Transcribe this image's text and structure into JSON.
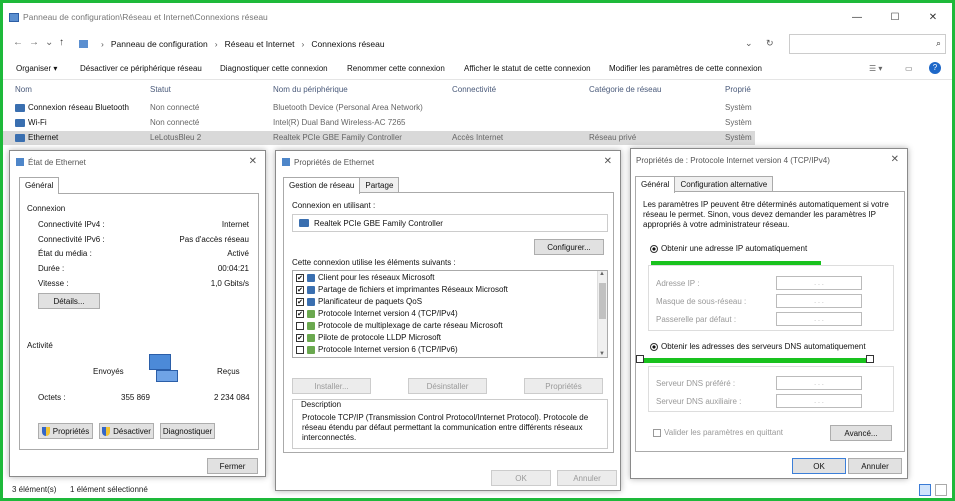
{
  "explorer": {
    "title": "Panneau de configuration\\Réseau et Internet\\Connexions réseau",
    "window_controls": {
      "min": "—",
      "max": "☐",
      "close": "✕"
    },
    "breadcrumb": [
      "Panneau de configuration",
      "Réseau et Internet",
      "Connexions réseau"
    ],
    "commands": [
      "Organiser ▾",
      "Désactiver ce périphérique réseau",
      "Diagnostiquer cette connexion",
      "Renommer cette connexion",
      "Afficher le statut de cette connexion",
      "Modifier les paramètres de cette connexion"
    ],
    "columns": [
      "Nom",
      "Statut",
      "Nom du périphérique",
      "Connectivité",
      "Catégorie de réseau",
      "Proprié"
    ],
    "rows": [
      {
        "name": "Connexion réseau Bluetooth",
        "status": "Non connecté",
        "device": "Bluetooth Device (Personal Area Network)",
        "connectivity": "",
        "category": "",
        "owner": "Systèm"
      },
      {
        "name": "Wi-Fi",
        "status": "Non connecté",
        "device": "Intel(R) Dual Band Wireless-AC 7265",
        "connectivity": "",
        "category": "",
        "owner": "Systèm"
      },
      {
        "name": "Ethernet",
        "status": "LeLotusBleu 2",
        "device": "Realtek PCIe GBE Family Controller",
        "connectivity": "Accès Internet",
        "category": "Réseau privé",
        "owner": "Systèm"
      }
    ],
    "status_count": "3 élément(s)",
    "status_selected": "1 élément sélectionné"
  },
  "etat": {
    "title": "État de Ethernet",
    "tab": "Général",
    "connexion_heading": "Connexion",
    "fields": [
      {
        "label": "Connectivité IPv4 :",
        "value": "Internet"
      },
      {
        "label": "Connectivité IPv6 :",
        "value": "Pas d'accès réseau"
      },
      {
        "label": "État du média :",
        "value": "Activé"
      },
      {
        "label": "Durée :",
        "value": "00:04:21"
      },
      {
        "label": "Vitesse :",
        "value": "1,0 Gbits/s"
      }
    ],
    "details_btn": "Détails...",
    "activite_heading": "Activité",
    "sent_label": "Envoyés",
    "recv_label": "Reçus",
    "octets_label": "Octets :",
    "sent_value": "355 869",
    "recv_value": "2 234 084",
    "btn_props": "Propriétés",
    "btn_disable": "Désactiver",
    "btn_diag": "Diagnostiquer",
    "btn_close": "Fermer"
  },
  "props": {
    "title": "Propriétés de Ethernet",
    "tab1": "Gestion de réseau",
    "tab2": "Partage",
    "conn_using": "Connexion en utilisant :",
    "adapter": "Realtek PCIe GBE Family Controller",
    "configure_btn": "Configurer...",
    "items_label": "Cette connexion utilise les éléments suivants :",
    "items": [
      {
        "label": "Client pour les réseaux Microsoft",
        "checked": "✔"
      },
      {
        "label": "Partage de fichiers et imprimantes Réseaux Microsoft",
        "checked": "✔"
      },
      {
        "label": "Planificateur de paquets QoS",
        "checked": "✔"
      },
      {
        "label": "Protocole Internet version 4 (TCP/IPv4)",
        "checked": "✔"
      },
      {
        "label": "Protocole de multiplexage de carte réseau Microsoft",
        "checked": ""
      },
      {
        "label": "Pilote de protocole LLDP Microsoft",
        "checked": "✔"
      },
      {
        "label": "Protocole Internet version 6 (TCP/IPv6)",
        "checked": ""
      }
    ],
    "install_btn": "Installer...",
    "uninstall_btn": "Désinstaller",
    "properties_btn": "Propriétés",
    "desc_heading": "Description",
    "desc_text": "Protocole TCP/IP (Transmission Control Protocol/Internet Protocol). Protocole de réseau étendu par défaut permettant la communication entre différents réseaux interconnectés.",
    "ok_btn": "OK",
    "cancel_btn": "Annuler"
  },
  "ipv4": {
    "title": "Propriétés de : Protocole Internet version 4 (TCP/IPv4)",
    "tab1": "Général",
    "tab2": "Configuration alternative",
    "intro": "Les paramètres IP peuvent être déterminés automatiquement si votre réseau le permet. Sinon, vous devez demander les paramètres IP appropriés à votre administrateur réseau.",
    "auto_ip": "Obtenir une adresse IP automatiquement",
    "ip_label": "Adresse IP :",
    "mask_label": "Masque de sous-réseau :",
    "gateway_label": "Passerelle par défaut :",
    "auto_dns": "Obtenir les adresses des serveurs DNS automatiquement",
    "dns1_label": "Serveur DNS préféré :",
    "dns2_label": "Serveur DNS auxiliaire :",
    "validate_label": "Valider les paramètres en quittant",
    "advanced_btn": "Avancé...",
    "ok_btn": "OK",
    "cancel_btn": "Annuler",
    "ip_placeholder": ".     .     .",
    "highlight_color": "#19c21e"
  }
}
